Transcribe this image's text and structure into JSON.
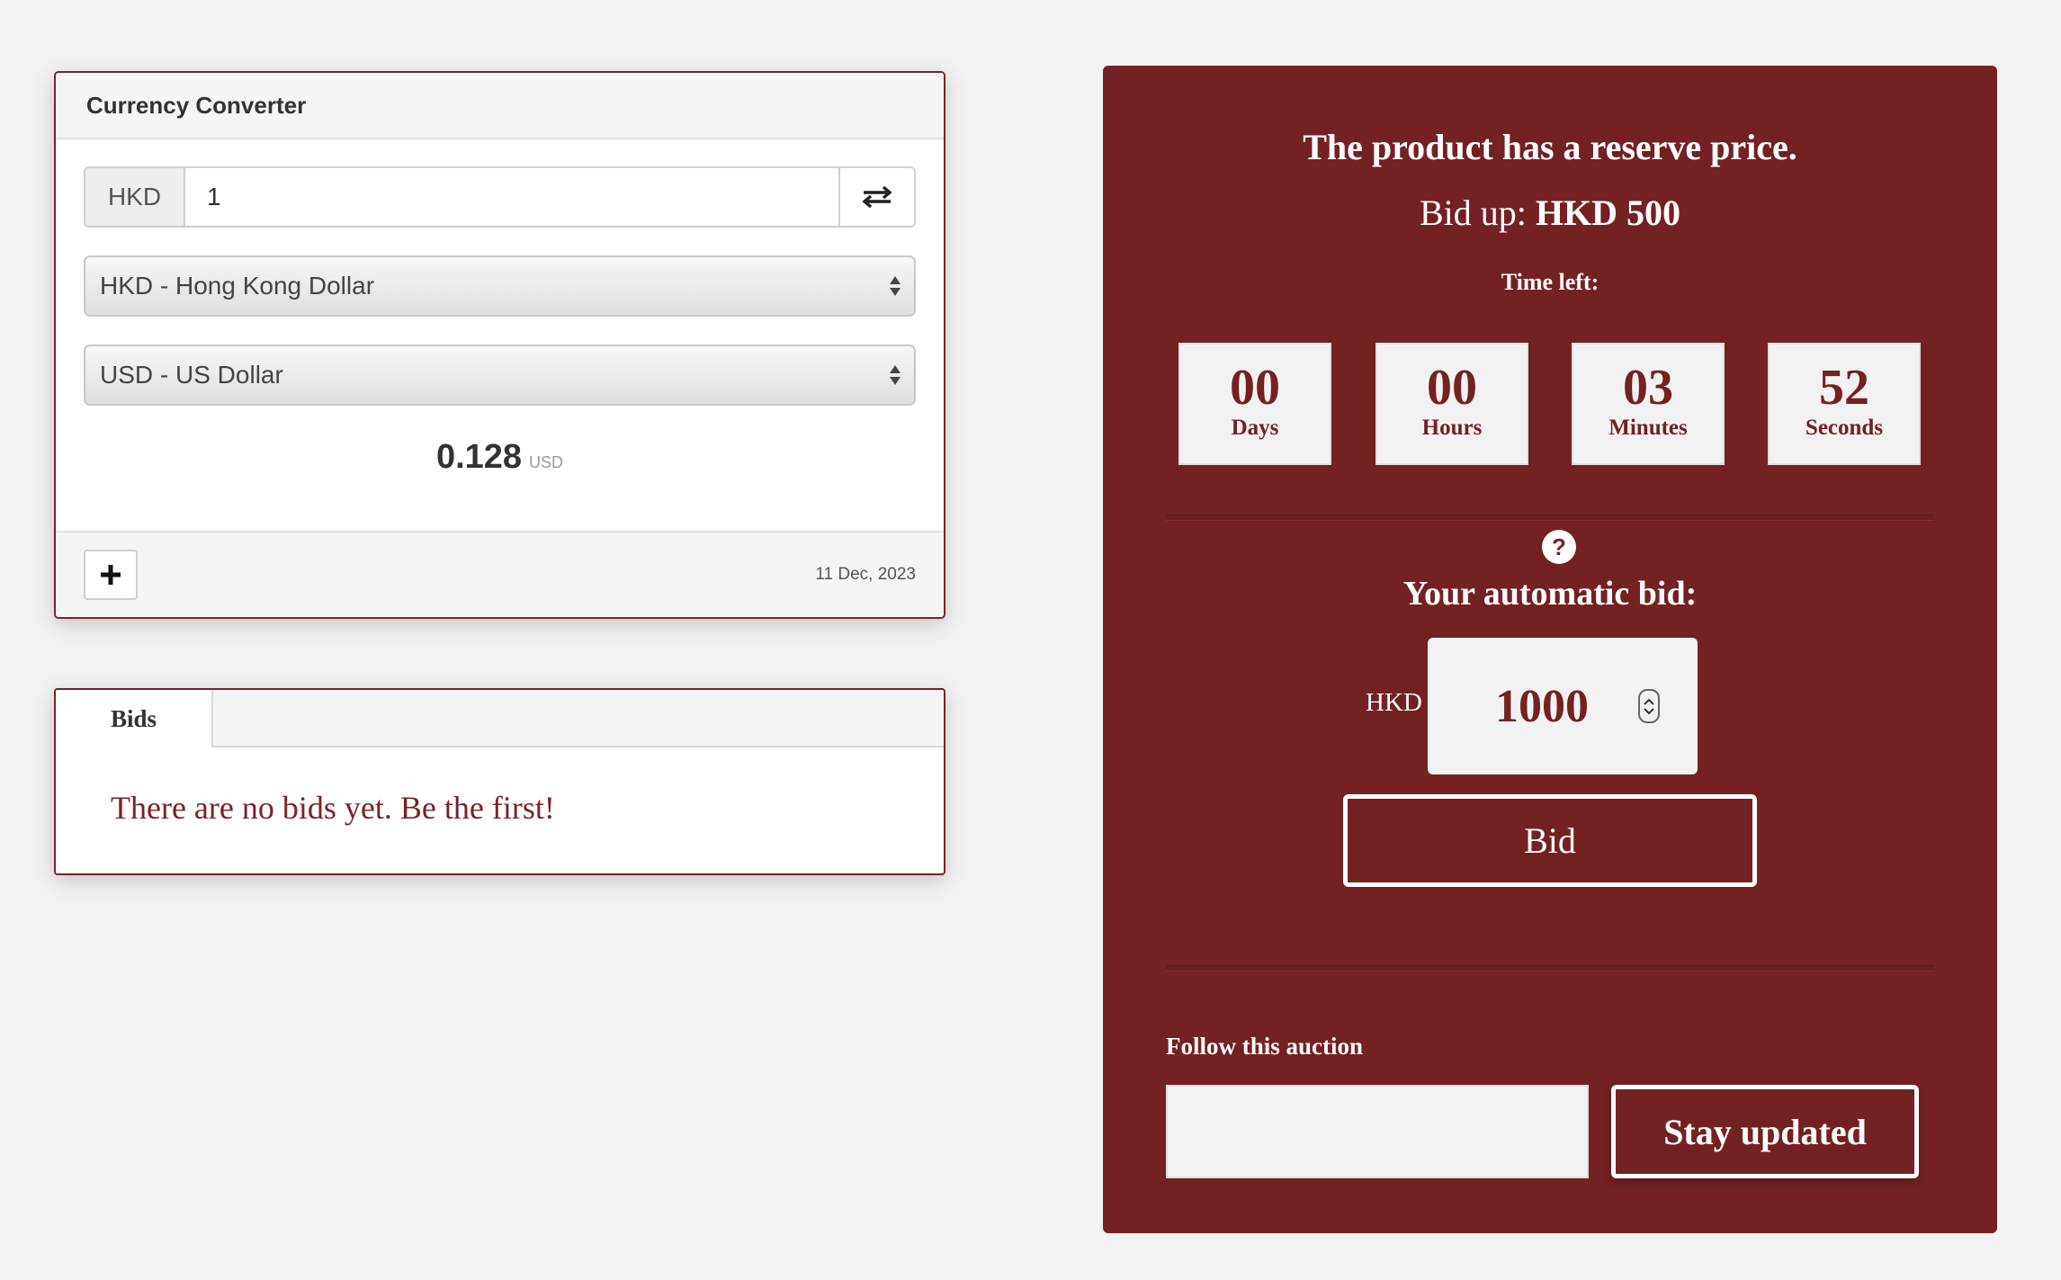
{
  "currency_converter": {
    "title": "Currency Converter",
    "from_code": "HKD",
    "amount": "1",
    "from_select": "HKD - Hong Kong Dollar",
    "to_select": "USD - US Dollar",
    "result_value": "0.128",
    "result_unit": "USD",
    "date": "11 Dec, 2023",
    "icons": {
      "swap": "swap-arrows-icon",
      "add": "plus-icon",
      "select": "sort-arrows-icon"
    }
  },
  "bids": {
    "tab_label": "Bids",
    "empty_message": "There are no bids yet. Be the first!"
  },
  "auction": {
    "reserve_text": "The product has a reserve price.",
    "bid_up_prefix": "Bid up:",
    "bid_up_value": "HKD 500",
    "time_left_label": "Time left:",
    "countdown": [
      {
        "value": "00",
        "label": "Days"
      },
      {
        "value": "00",
        "label": "Hours"
      },
      {
        "value": "03",
        "label": "Minutes"
      },
      {
        "value": "52",
        "label": "Seconds"
      }
    ],
    "help_glyph": "?",
    "automatic_bid_label": "Your automatic bid:",
    "bid_currency": "HKD",
    "bid_amount": "1000",
    "bid_button": "Bid",
    "follow_label": "Follow this auction",
    "follow_input_value": "",
    "stay_updated_button": "Stay updated"
  },
  "colors": {
    "accent": "#742123",
    "background": "#f2f2f2",
    "panel_border": "#7a2326"
  }
}
